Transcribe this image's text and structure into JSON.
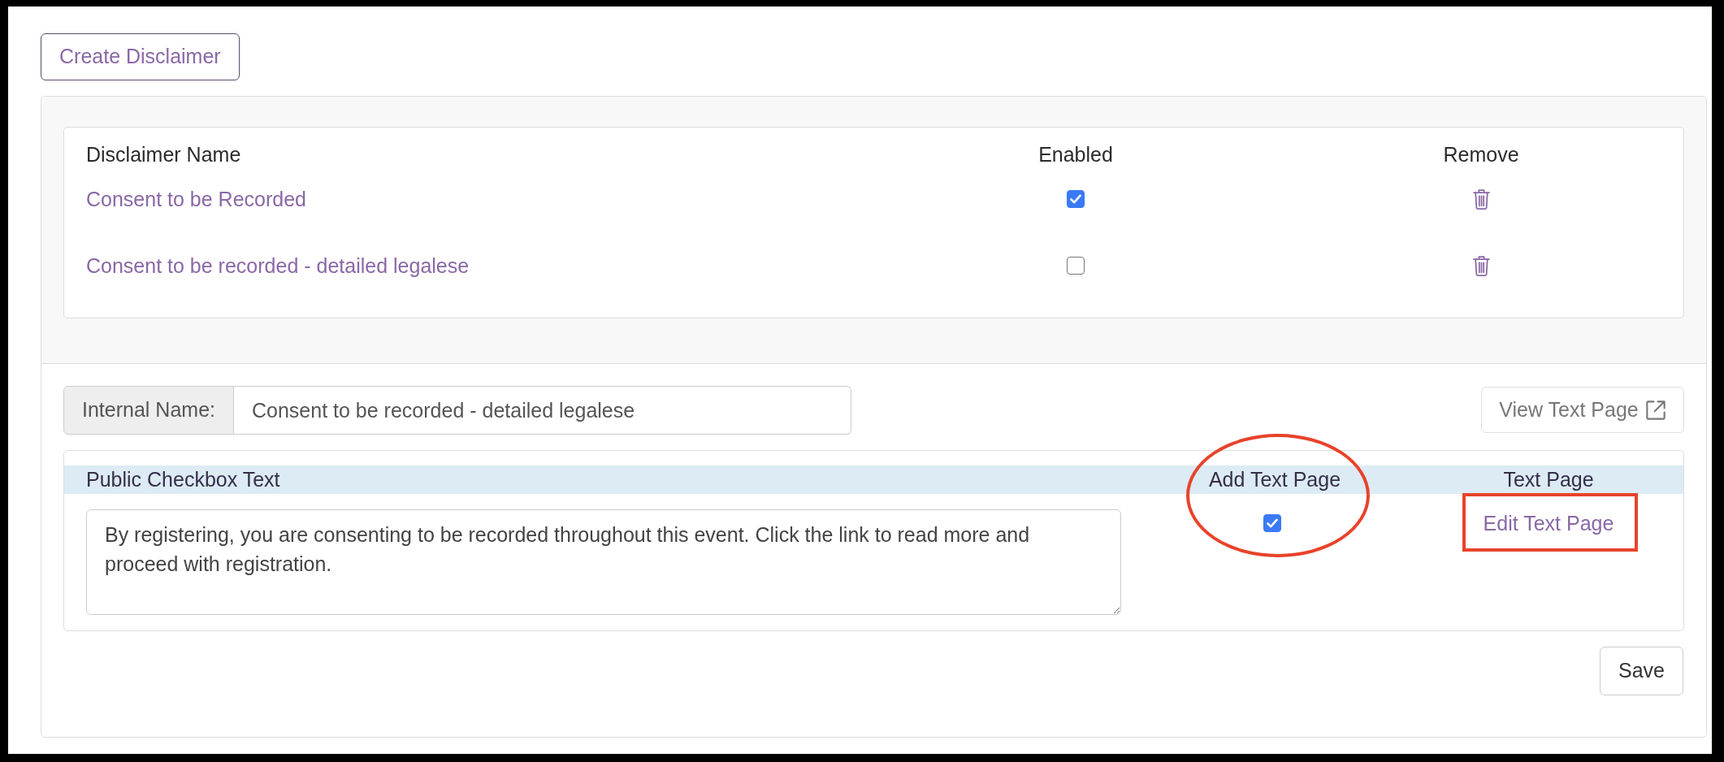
{
  "create_button": "Create Disclaimer",
  "disclaimers": {
    "columns": [
      "Disclaimer Name",
      "Enabled",
      "Remove"
    ],
    "rows": [
      {
        "name": "Consent to be Recorded",
        "enabled": true
      },
      {
        "name": "Consent to be recorded - detailed legalese",
        "enabled": false
      }
    ]
  },
  "editor": {
    "internal_name": {
      "label": "Internal Name:",
      "value": "Consent to be recorded - detailed legalese"
    },
    "view_button": "View Text Page",
    "columns": [
      "Public Checkbox Text",
      "Add Text Page",
      "Text Page"
    ],
    "public_checkbox_text": "By registering, you are consenting to be recorded throughout this event. Click the link to read more and proceed with registration.",
    "add_text_page": {
      "checked": true,
      "circled": true
    },
    "text_page_link": {
      "label": "Edit Text Page",
      "boxed": true
    },
    "save_button": "Save"
  }
}
